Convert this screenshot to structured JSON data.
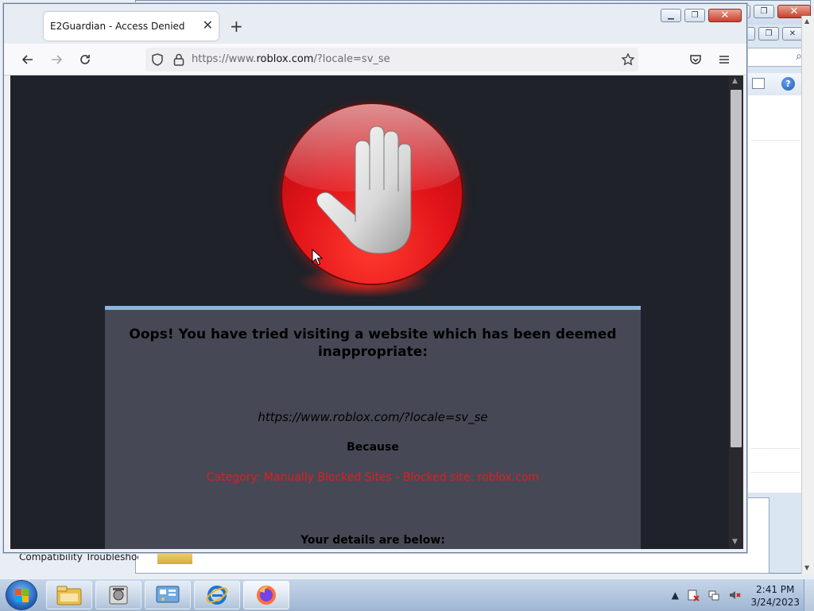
{
  "browser": {
    "tab_title": "E2Guardian - Access Denied",
    "tab_close": "✕",
    "new_tab": "+",
    "url_prefix": "https://www.",
    "url_host": "roblox.com",
    "url_suffix": "/?locale=sv_se"
  },
  "block_page": {
    "heading": "Oops! You have tried visiting a website which has been deemed inappropriate:",
    "blocked_url": "https://www.roblox.com/?locale=sv_se",
    "because_label": "Because",
    "category": "Category: Manually Blocked Sites - Blocked site: roblox.com",
    "details_label": "Your details are below:",
    "colors": {
      "background": "#1f2229",
      "panel": "#464955",
      "accent_bar": "#8db4de",
      "category_red": "#e11d1d",
      "stop_red": "#e2141a"
    }
  },
  "background_window": {
    "label": "Compatibility Troubleshoo"
  },
  "taskbar": {
    "items": [
      "explorer-folder",
      "archive-tool",
      "control-panel",
      "internet-explorer",
      "firefox"
    ],
    "tray_overflow": "▲",
    "clock_time": "2:41 PM",
    "clock_date": "3/24/2023"
  }
}
